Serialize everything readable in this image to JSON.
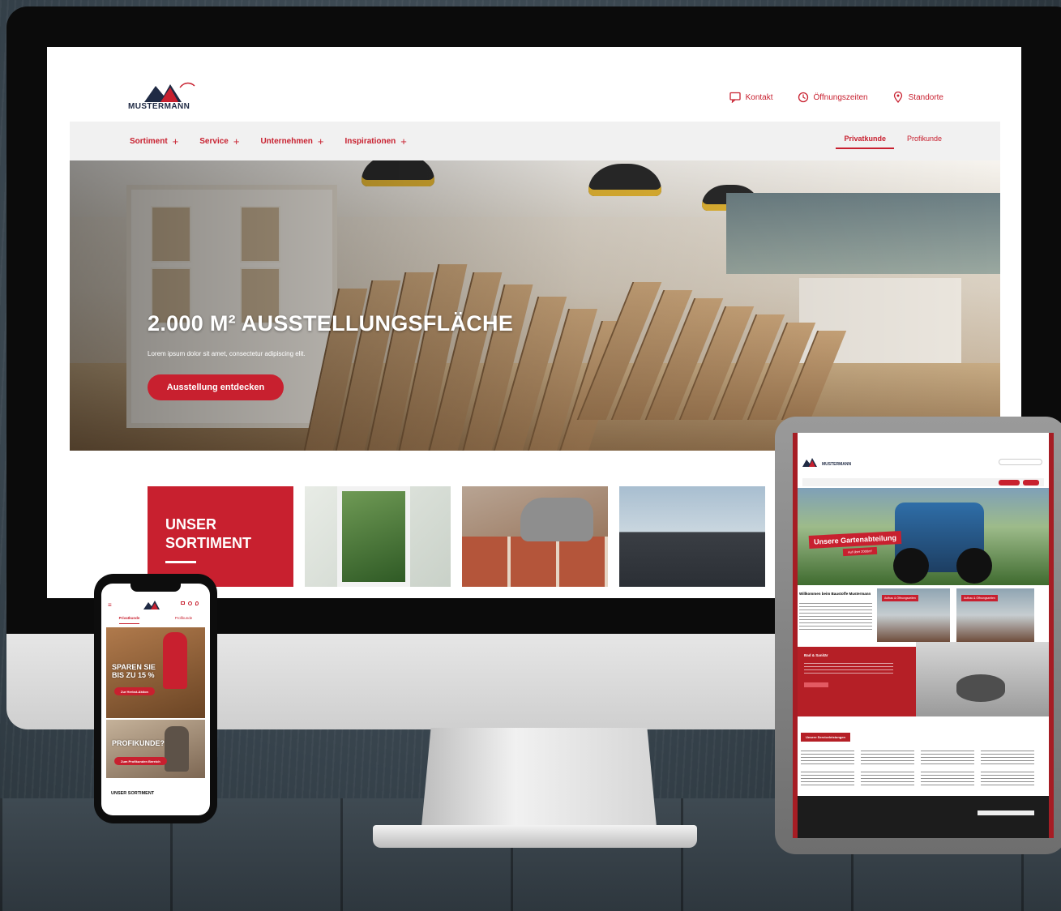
{
  "colors": {
    "brand_red": "#c8202f",
    "brand_navy": "#1f2a44",
    "nav_bg": "#f1f1f1"
  },
  "desktop": {
    "logo": {
      "name": "MUSTERMANN"
    },
    "top_links": [
      {
        "label": "Kontakt",
        "icon": "chat-icon"
      },
      {
        "label": "Öffnungszeiten",
        "icon": "clock-icon"
      },
      {
        "label": "Standorte",
        "icon": "location-pin-icon"
      }
    ],
    "nav": [
      {
        "label": "Sortiment"
      },
      {
        "label": "Service"
      },
      {
        "label": "Unternehmen"
      },
      {
        "label": "Inspirationen"
      }
    ],
    "customer_tabs": [
      {
        "label": "Privatkunde",
        "active": true
      },
      {
        "label": "Profikunde",
        "active": false
      }
    ],
    "hero": {
      "title": "2.000 M² AUSSTELLUNGSFLÄCHE",
      "text": "Lorem ipsum dolor sit amet, consectetur adipiscing elit.",
      "button": "Ausstellung entdecken"
    },
    "tiles": {
      "headline": "UNSER\nSORTIMENT"
    }
  },
  "phone": {
    "tabs": [
      {
        "label": "Privatkunde",
        "active": true
      },
      {
        "label": "Profikunde",
        "active": false
      }
    ],
    "hero1": {
      "title": "SPAREN SIE\nBIS ZU 15 %",
      "button": "Zur Herbst-Aktion"
    },
    "hero2": {
      "title": "PROFIKUNDE?",
      "button": "Zum Profikunden Bereich"
    },
    "section": "UNSER SORTIMENT"
  },
  "tablet": {
    "logo": "MUSTERMANN",
    "hero_label": "Unsere Gartenabteilung",
    "hero_sub": "Auf über 2000m²",
    "welcome": "Willkommen beim Baustoffe Mustermann",
    "store_tags": [
      "Aufbau & Öffnungszeiten",
      "Aufbau & Öffnungszeiten"
    ],
    "bath_title": "Bad & Sanitär",
    "services_label": "Unsere Serviceleistungen"
  }
}
